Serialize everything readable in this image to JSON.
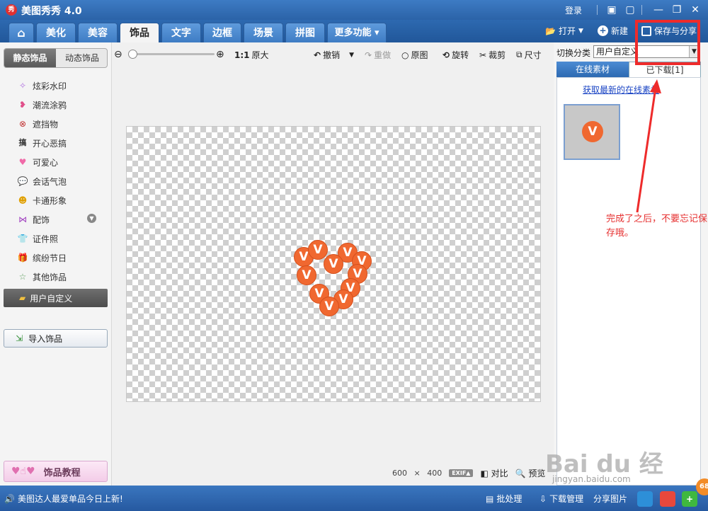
{
  "titlebar": {
    "logo": "秀",
    "title": "美图秀秀 4.0",
    "login": "登录"
  },
  "tabs": [
    {
      "label": "⌂"
    },
    {
      "label": "美化"
    },
    {
      "label": "美容"
    },
    {
      "label": "饰品"
    },
    {
      "label": "文字"
    },
    {
      "label": "边框"
    },
    {
      "label": "场景"
    },
    {
      "label": "拼图"
    },
    {
      "label": "更多功能 ▾"
    }
  ],
  "top_actions": {
    "open": "打开",
    "new": "新建",
    "save_share": "保存与分享"
  },
  "left_panel": {
    "tab_static": "静态饰品",
    "tab_dynamic": "动态饰品",
    "categories": [
      {
        "label": "炫彩水印",
        "icon": "sparkle-icon"
      },
      {
        "label": "潮流涂鸦",
        "icon": "lips-icon"
      },
      {
        "label": "遮挡物",
        "icon": "mask-icon"
      },
      {
        "label": "开心恶搞",
        "icon": "prank-icon"
      },
      {
        "label": "可爱心",
        "icon": "heart-icon"
      },
      {
        "label": "会话气泡",
        "icon": "speech-bubble-icon"
      },
      {
        "label": "卡通形象",
        "icon": "cartoon-icon"
      },
      {
        "label": "配饰",
        "icon": "bow-icon"
      },
      {
        "label": "证件照",
        "icon": "shirt-icon"
      },
      {
        "label": "缤纷节日",
        "icon": "gift-icon"
      },
      {
        "label": "其他饰品",
        "icon": "star-icon"
      }
    ],
    "user_custom": "用户自定义",
    "import": "导入饰品",
    "tutorial": "饰品教程"
  },
  "toolbar": {
    "zoom_ratio": "1:1",
    "original_size": "原大",
    "undo": "撤销",
    "redo": "重做",
    "original_image": "原图",
    "rotate": "旋转",
    "crop": "裁剪",
    "size": "尺寸"
  },
  "canvas": {
    "width_value": "600",
    "times": "×",
    "height_value": "400",
    "exif": "EXIF▲",
    "compare": "对比",
    "preview": "预览"
  },
  "right_panel": {
    "switch_label": "切换分类",
    "select_value": "用户自定义",
    "tab_online": "在线素材",
    "tab_downloaded": "已下载[1]",
    "get_latest": "获取最新的在线素材",
    "thumb_letter": "V"
  },
  "annotation": {
    "text": "完成了之后，不要忘记保存哦。"
  },
  "watermark": {
    "main": "Bai du 经验",
    "url": "jingyan.baidu.com"
  },
  "bottombar": {
    "news": "美图达人最爱单品今日上新!",
    "batch": "批处理",
    "download_manage": "下载管理",
    "share_image": "分享图片",
    "badge": "68"
  },
  "colors": {
    "brand_blue": "#2b63a8",
    "accent_orange": "#f06830",
    "annotation_red": "#ee2b2b"
  }
}
